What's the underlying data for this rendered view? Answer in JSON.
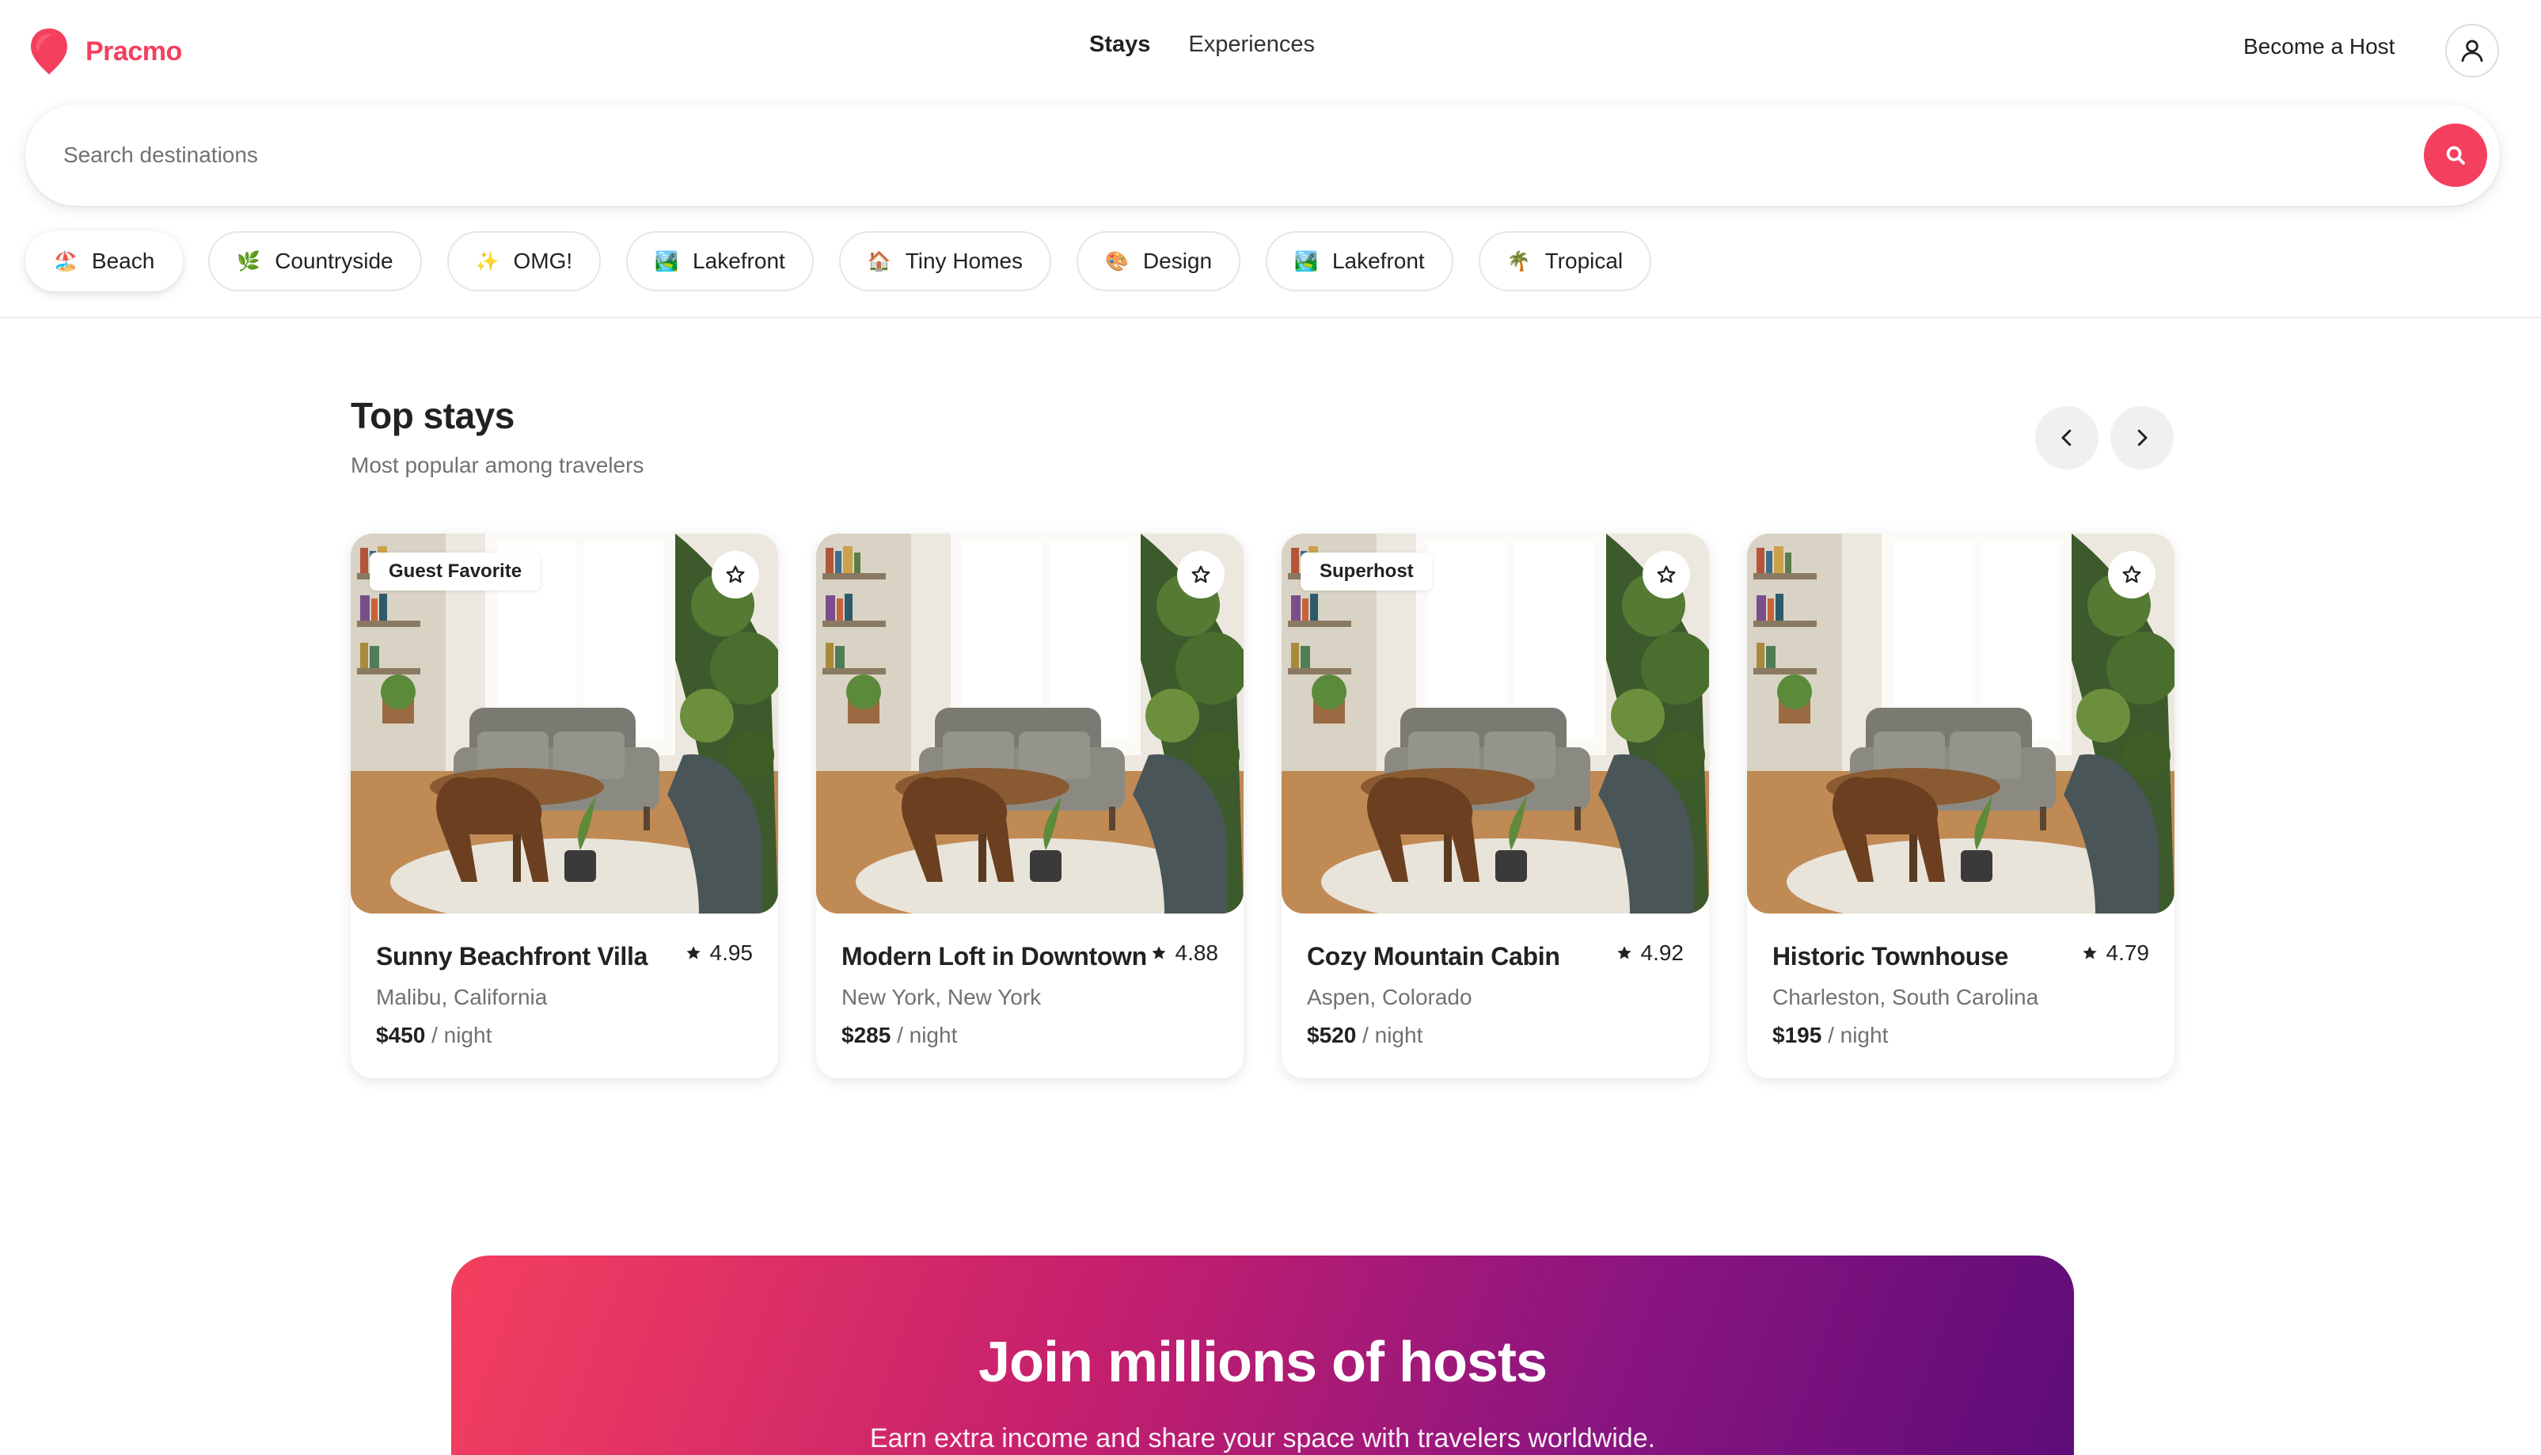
{
  "brand": {
    "name": "Pracmo",
    "color": "#f43f5e"
  },
  "nav": {
    "items": [
      {
        "label": "Stays",
        "active": true
      },
      {
        "label": "Experiences",
        "active": false
      }
    ]
  },
  "header": {
    "host_link": "Become a Host"
  },
  "search": {
    "placeholder": "Search destinations",
    "value": ""
  },
  "categories": [
    {
      "emoji": "🏖️",
      "label": "Beach"
    },
    {
      "emoji": "🌿",
      "label": "Countryside"
    },
    {
      "emoji": "✨",
      "label": "OMG!"
    },
    {
      "emoji": "🏞️",
      "label": "Lakefront"
    },
    {
      "emoji": "🏠",
      "label": "Tiny Homes"
    },
    {
      "emoji": "🎨",
      "label": "Design"
    },
    {
      "emoji": "🏞️",
      "label": "Lakefront"
    },
    {
      "emoji": "🌴",
      "label": "Tropical"
    }
  ],
  "section": {
    "title": "Top stays",
    "subtitle": "Most popular among travelers"
  },
  "listings": [
    {
      "badge": "Guest Favorite",
      "title": "Sunny Beachfront Villa",
      "rating": "4.95",
      "location": "Malibu, California",
      "price": "$450",
      "price_unit": "/ night"
    },
    {
      "badge": "",
      "title": "Modern Loft in Downtown",
      "rating": "4.88",
      "location": "New York, New York",
      "price": "$285",
      "price_unit": "/ night"
    },
    {
      "badge": "Superhost",
      "title": "Cozy Mountain Cabin",
      "rating": "4.92",
      "location": "Aspen, Colorado",
      "price": "$520",
      "price_unit": "/ night"
    },
    {
      "badge": "",
      "title": "Historic Townhouse",
      "rating": "4.79",
      "location": "Charleston, South Carolina",
      "price": "$195",
      "price_unit": "/ night"
    }
  ],
  "banner": {
    "title": "Join millions of hosts",
    "subtitle": "Earn extra income and share your space with travelers worldwide."
  }
}
